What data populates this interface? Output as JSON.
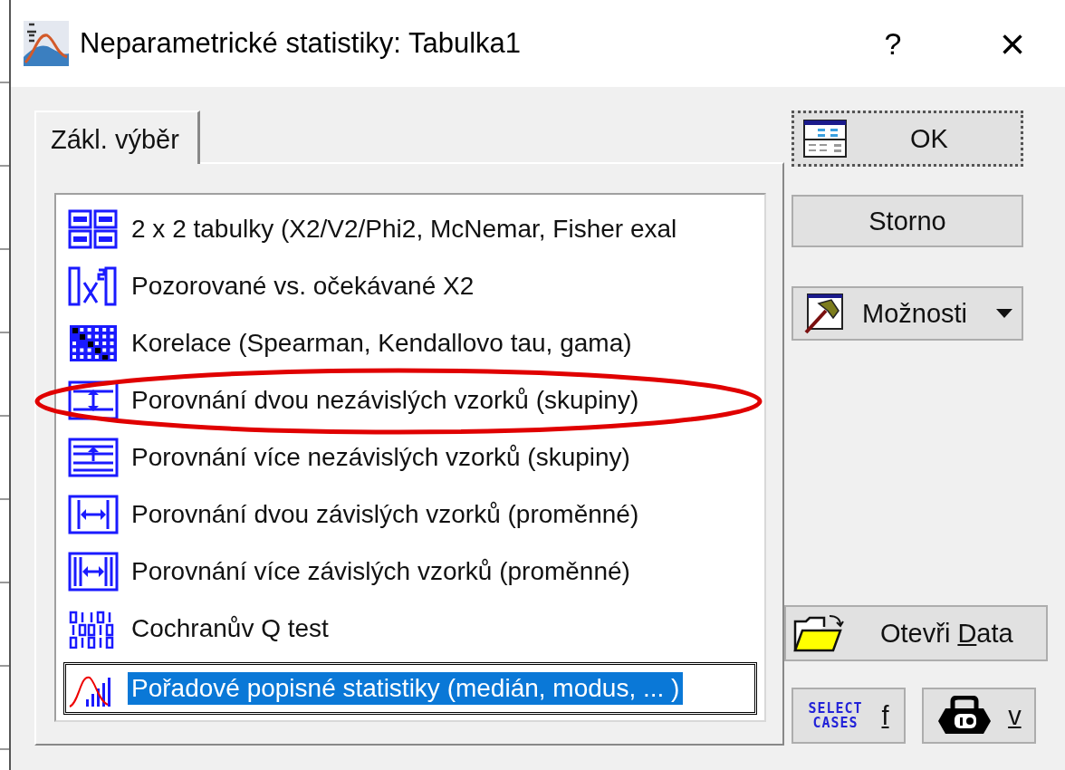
{
  "window": {
    "title": "Neparametrické statistiky: Tabulka1",
    "help": "?",
    "close": "×"
  },
  "tabs": [
    {
      "label": "Zákl. výběr",
      "selected": true
    }
  ],
  "list": {
    "items": [
      {
        "kind": "table2x2",
        "label": "2 x 2 tabulky (X2/V2/Phi2, McNemar, Fisher exal",
        "selected": false,
        "circled": false
      },
      {
        "kind": "chi",
        "label": "Pozorované vs. očekávané X2",
        "selected": false,
        "circled": false
      },
      {
        "kind": "matrix",
        "label": "Korelace (Spearman, Kendallovo tau, gama)",
        "selected": false,
        "circled": false
      },
      {
        "kind": "two-indep",
        "label": "Porovnání dvou nezávislých vzorků (skupiny)",
        "selected": false,
        "circled": true
      },
      {
        "kind": "multi-indep",
        "label": "Porovnání více nezávislých vzorků (skupiny)",
        "selected": false,
        "circled": false
      },
      {
        "kind": "two-dep",
        "label": "Porovnání dvou závislých vzorků (proměnné)",
        "selected": false,
        "circled": false
      },
      {
        "kind": "multi-dep",
        "label": "Porovnání více závislých vzorků (proměnné)",
        "selected": false,
        "circled": false
      },
      {
        "kind": "binary",
        "label": "Cochranův Q test",
        "selected": false,
        "circled": false
      },
      {
        "kind": "rank",
        "label": "Pořadové popisné statistiky (medián, modus, ... )",
        "selected": true,
        "circled": false
      }
    ]
  },
  "buttons": {
    "ok": {
      "label": "OK"
    },
    "cancel": {
      "label": "Storno"
    },
    "options": {
      "label": "Možnosti"
    },
    "open_data": {
      "before": "Otevři ",
      "key": "D",
      "after": "ata"
    },
    "select_cases": {
      "icon_text": [
        "SELECT",
        "CASES"
      ],
      "key": "f"
    },
    "weight": {
      "key": "v"
    }
  }
}
